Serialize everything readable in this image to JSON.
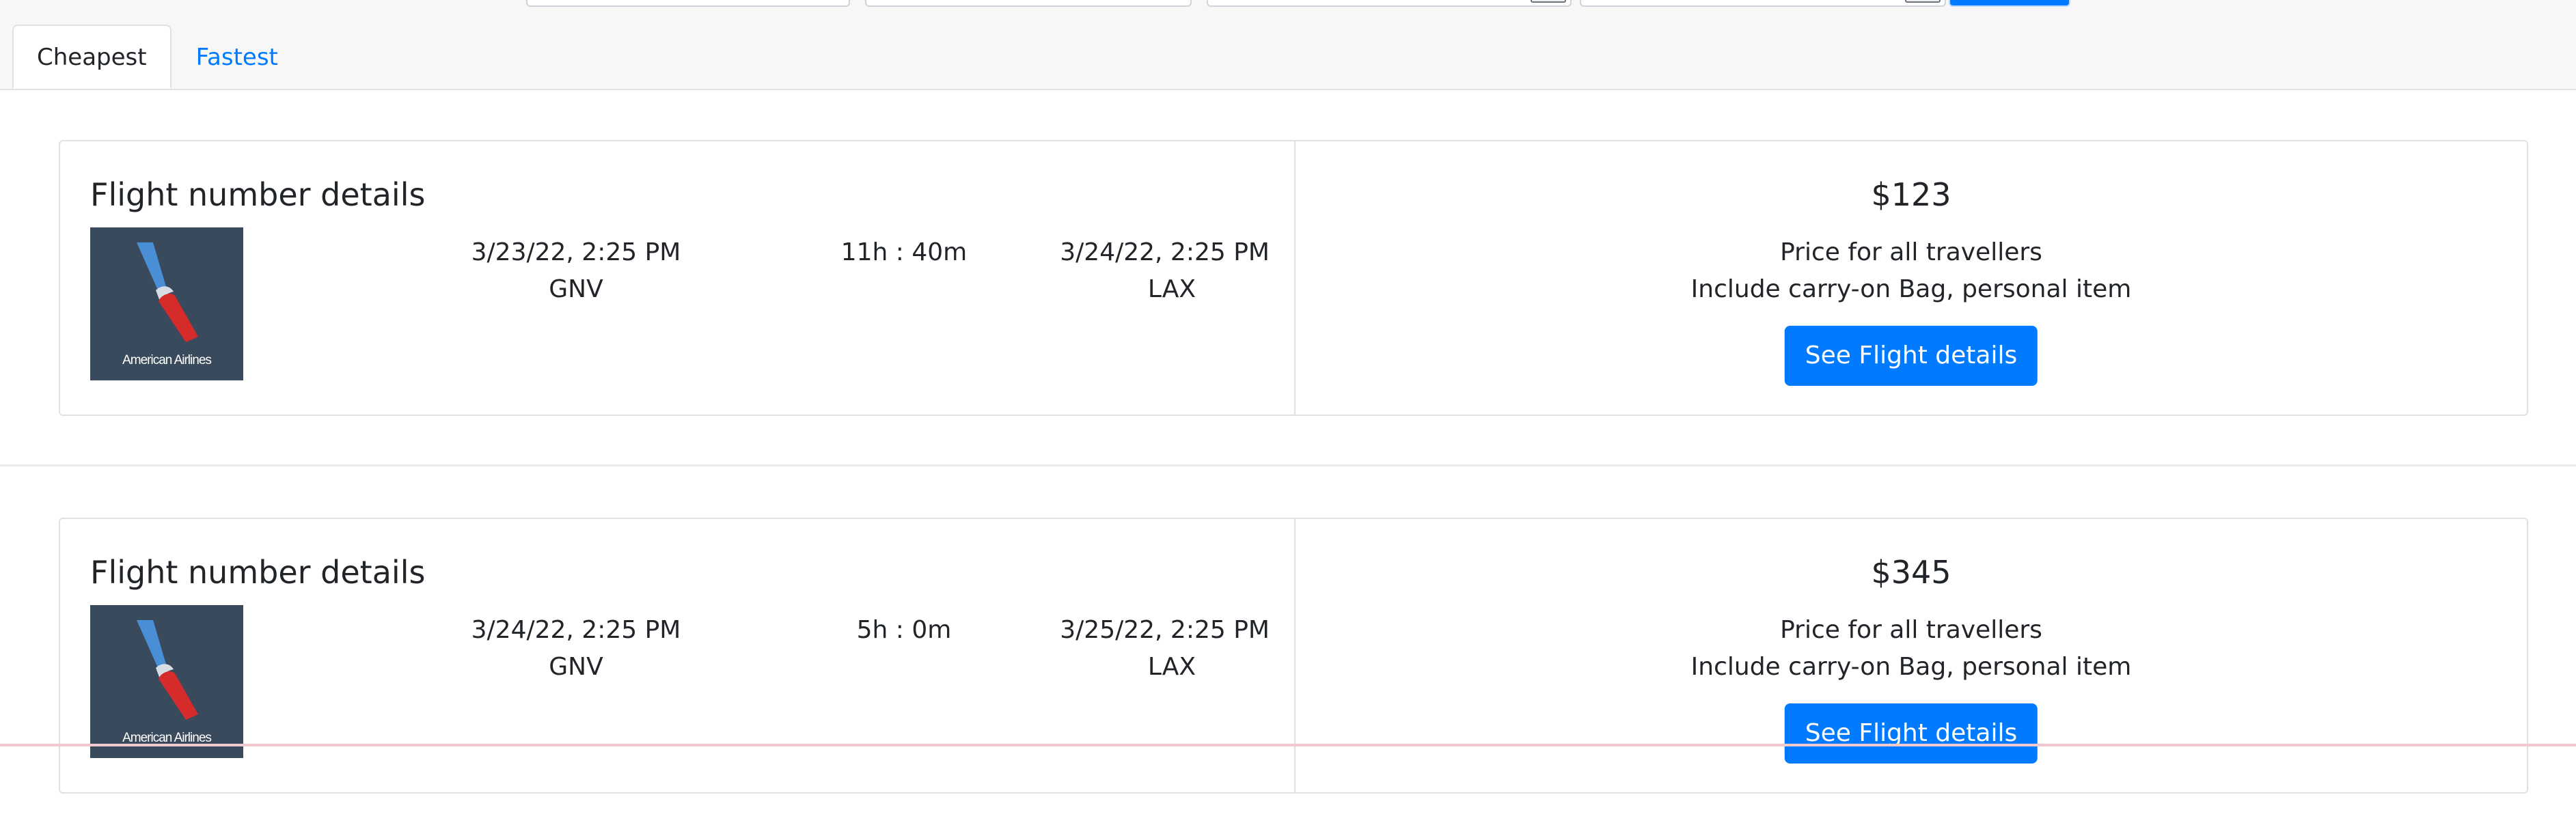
{
  "tabs": [
    {
      "label": "Cheapest",
      "active": true
    },
    {
      "label": "Fastest",
      "active": false
    }
  ],
  "airline_logo": {
    "icon": "american-airlines-logo-icon",
    "text": "American Airlines"
  },
  "results": [
    {
      "title": "Flight number details",
      "depart_time": "3/23/22, 2:25 PM",
      "depart_airport": "GNV",
      "duration": "11h : 40m",
      "arrive_time": "3/24/22, 2:25 PM",
      "arrive_airport": "LAX",
      "price": "$123",
      "price_note": "Price for all travellers",
      "baggage_note": "Include carry-on Bag, personal item",
      "button_label": "See Flight details"
    },
    {
      "title": "Flight number details",
      "depart_time": "3/24/22, 2:25 PM",
      "depart_airport": "GNV",
      "duration": "5h : 0m",
      "arrive_time": "3/25/22, 2:25 PM",
      "arrive_airport": "LAX",
      "price": "$345",
      "price_note": "Price for all travellers",
      "baggage_note": "Include carry-on Bag, personal item",
      "button_label": "See Flight details"
    }
  ],
  "colors": {
    "accent": "#007bff",
    "logo_background": "#394a5c",
    "logo_blue": "#4a8fd6",
    "logo_red": "#d52b2b",
    "border": "#dfe2e5"
  }
}
